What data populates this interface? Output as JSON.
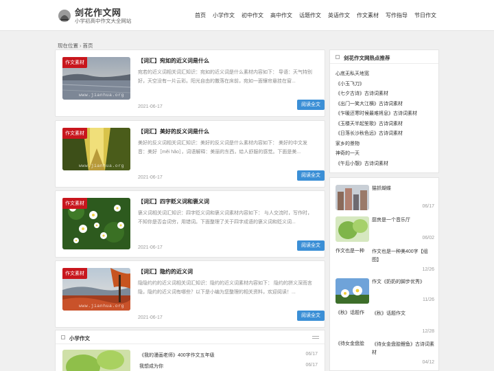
{
  "site": {
    "title": "剑花作文网",
    "subtitle": "小学初高中作文大全网站"
  },
  "nav": [
    "首页",
    "小学作文",
    "初中作文",
    "高中作文",
    "话题作文",
    "英语作文",
    "作文素材",
    "写作指导",
    "节日作文"
  ],
  "breadcrumb": {
    "label": "现在位置",
    "current": "首页"
  },
  "articles": [
    {
      "tag": "作文素材",
      "title": "【词汇】宛如的近义词是什么",
      "desc": "宛若的近义词相关词汇知识：宛如的近义词是什么素材内容如下： 导语：天气特别好，天空没有一片云彩。阳光自由的撒落在床前，宛如一面镶帘悬挂在窗...",
      "date": "2021-06-17",
      "button": "阅读全文",
      "watermark": "www.jianhua.org",
      "image": "lake"
    },
    {
      "tag": "作文素材",
      "title": "【词汇】美好的反义词是什么",
      "desc": "美好的反义词相关词汇知识：美好的反义词是什么素材内容如下： 美好的中文发音：美好［měi hǎo］，词语解释：美丽的东西，给人舒服的感觉。下面是美...",
      "date": "2021-06-17",
      "button": "阅读全文",
      "watermark": "www.jianhua.org",
      "image": "forest"
    },
    {
      "tag": "作文素材",
      "title": "【词汇】四字贬义词和褒义词",
      "desc": "褒义词相关词汇知识：四字贬义词和褒义词素材内容如下： 与人交流时，写作时，不知你是否会词穷，用错词。下面整理了关于四字成语的褒义词和贬义词...",
      "date": "2021-06-17",
      "button": "阅读全文",
      "watermark": "",
      "image": "daisies"
    },
    {
      "tag": "作文素材",
      "title": "【词汇】隐约的近义词",
      "desc": "隐隐约约的近义词相关词汇知识：隐约的近义词素材内容如下： 隐约的拼义深而言隐，隐约的近义词有哪些？以下是小编为您整理的相关资料，欢迎阅读！...",
      "date": "2021-06-17",
      "button": "阅读全文",
      "watermark": "www.jianhua.org",
      "image": "autumn"
    }
  ],
  "section": {
    "title": "小学作文",
    "items": [
      {
        "title": "《我的漫画老师》400字作文五年级",
        "date": "06/17"
      },
      {
        "title": "我想成为你",
        "date": "06/17"
      }
    ]
  },
  "sidebar_hot": {
    "title": "剑花作文网热点推荐",
    "items": [
      "心底无私天地宽",
      "《小玉飞刀》",
      "《七夕古诗》古诗词素材",
      "《出门一笑大江横》古诗词素材",
      "《乍暖还寒时候最难将息》古诗词素材",
      "《玉楼天半起笙歌》古诗词素材",
      "《日落长沙秋色远》古诗词素材",
      "家乡的景物",
      "神奇的一天",
      "《午后小憩》古诗词素材"
    ]
  },
  "sidebar_recent": [
    {
      "title": "猫抓蝴蝶",
      "date": "06/17",
      "image": "city"
    },
    {
      "title": "厨房是一个音乐厅",
      "date": "06/02",
      "image": "green"
    },
    {
      "alt": "作文也是一种",
      "title": "作文也是一种美400字【组图】",
      "date": "12/26",
      "image": ""
    },
    {
      "title": "作文《奶奶的脚步优秀》",
      "date": "11/26",
      "image": "sky"
    },
    {
      "alt": "《秋》话题作",
      "title": "《秋》话题作文",
      "date": "12/28",
      "image": ""
    },
    {
      "alt": "《待女金盘脍",
      "title": "《待女金盘脍鲤鱼》古诗词素材",
      "date": "04/12",
      "image": ""
    }
  ]
}
